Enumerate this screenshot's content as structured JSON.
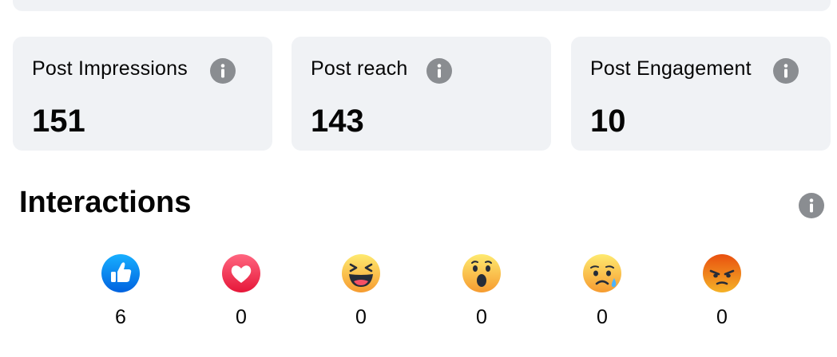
{
  "stats": [
    {
      "label": "Post Impressions",
      "value": "151"
    },
    {
      "label": "Post reach",
      "value": "143"
    },
    {
      "label": "Post Engagement",
      "value": "10"
    }
  ],
  "interactions": {
    "title": "Interactions",
    "reactions": [
      {
        "icon": "like-icon",
        "count": "6"
      },
      {
        "icon": "love-icon",
        "count": "0"
      },
      {
        "icon": "haha-icon",
        "count": "0"
      },
      {
        "icon": "wow-icon",
        "count": "0"
      },
      {
        "icon": "sad-icon",
        "count": "0"
      },
      {
        "icon": "angry-icon",
        "count": "0"
      }
    ]
  },
  "colors": {
    "card_bg": "#f0f2f5",
    "info_icon": "#8a8d91",
    "like_blue": "#1877f2",
    "love_red": "#f33e58",
    "emoji_yellow": "#f7b125",
    "angry_orange": "#e9710f"
  }
}
